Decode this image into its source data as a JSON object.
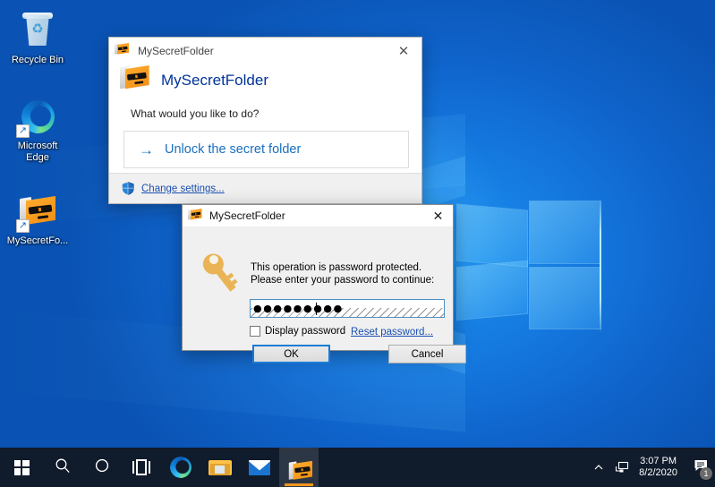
{
  "desktop": {
    "icons": [
      {
        "label": "Recycle Bin",
        "icon": "recycle-bin-icon"
      },
      {
        "label": "Microsoft\nEdge",
        "label_line1": "Microsoft",
        "label_line2": "Edge",
        "icon": "microsoft-edge-icon"
      },
      {
        "label": "MySecretFo...",
        "icon": "mysecretfolder-icon"
      }
    ]
  },
  "main_window": {
    "title": "MySecretFolder",
    "close_label": "✕",
    "header_title": "MySecretFolder",
    "question": "What would you like to do?",
    "task": {
      "arrow": "→",
      "label": "Unlock the secret folder"
    },
    "footer": {
      "link": "Change settings...",
      "shield_icon": "uac-shield-icon"
    }
  },
  "password_dialog": {
    "title": "MySecretFolder",
    "close_label": "✕",
    "key_icon": "key-icon",
    "message_line1": "This operation is password protected.",
    "message_line2": "Please enter your password to continue:",
    "password_value": "●●●●●●●●●",
    "password_placeholder": "",
    "display_password_label": "Display password",
    "display_password_checked": false,
    "reset_link": "Reset password...",
    "ok_label": "OK",
    "cancel_label": "Cancel"
  },
  "taskbar": {
    "start_label": "Start",
    "items": [
      {
        "name": "start-button",
        "icon": "windows-logo-icon"
      },
      {
        "name": "search-button",
        "icon": "search-icon"
      },
      {
        "name": "cortana-button",
        "icon": "cortana-circle-icon"
      },
      {
        "name": "task-view-button",
        "icon": "task-view-icon"
      },
      {
        "name": "taskbar-edge",
        "icon": "microsoft-edge-icon"
      },
      {
        "name": "taskbar-file-explorer",
        "icon": "file-explorer-icon"
      },
      {
        "name": "taskbar-mail",
        "icon": "mail-icon"
      },
      {
        "name": "taskbar-mysecretfolder",
        "icon": "mysecretfolder-icon",
        "active": true
      }
    ],
    "tray": {
      "show_hidden_icon": "chevron-up-icon",
      "network_icon": "network-icon",
      "time": "3:07 PM",
      "date": "8/2/2020",
      "notification_icon": "action-center-icon",
      "notification_count": "1"
    }
  },
  "colors": {
    "accent_blue": "#1a6fbf",
    "link_blue": "#1a4fb0",
    "header_title": "#003399",
    "taskbar_bg": "#101b2b",
    "active_indicator": "#f0951e",
    "focus_border": "#1a7bd4"
  }
}
